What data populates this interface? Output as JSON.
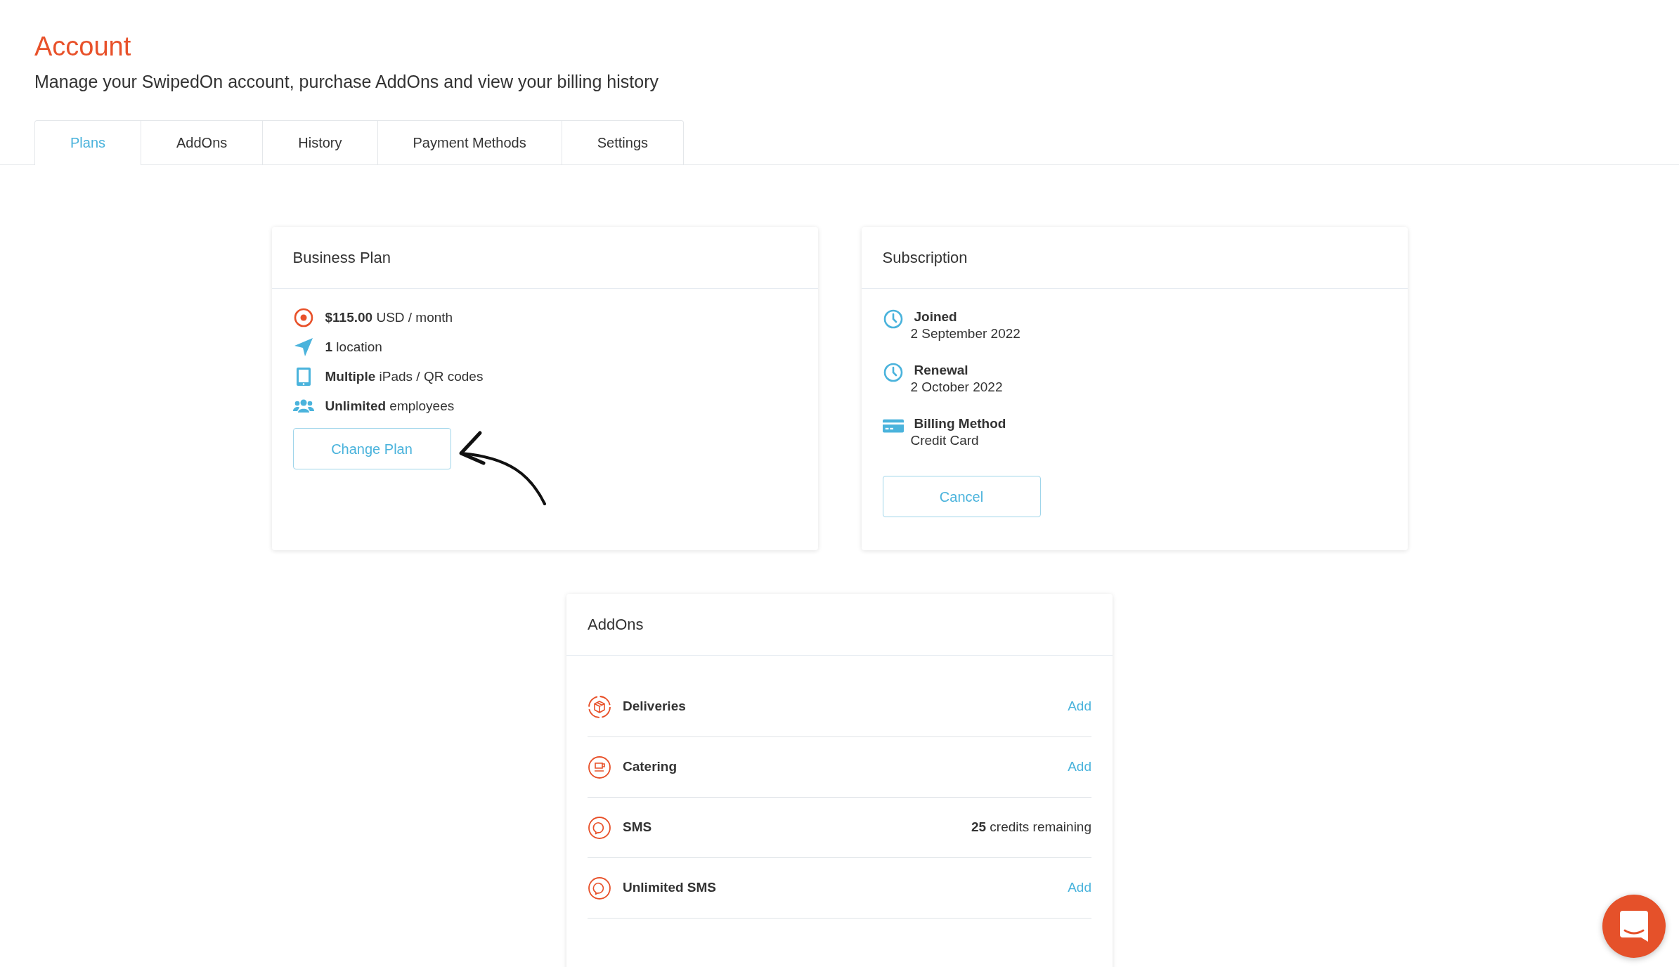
{
  "page": {
    "title": "Account",
    "subtitle": "Manage your SwipedOn account, purchase AddOns and view your billing history"
  },
  "tabs": [
    {
      "label": "Plans",
      "selected": true
    },
    {
      "label": "AddOns",
      "selected": false
    },
    {
      "label": "History",
      "selected": false
    },
    {
      "label": "Payment Methods",
      "selected": false
    },
    {
      "label": "Settings",
      "selected": false
    }
  ],
  "plan_card": {
    "title": "Business Plan",
    "features": [
      {
        "kind": "price",
        "text": "**$115.00** USD / month"
      },
      {
        "kind": "location",
        "text": "**1** location"
      },
      {
        "kind": "device",
        "text": "**Multiple** iPads / QR codes"
      },
      {
        "kind": "people",
        "text": "**Unlimited** employees"
      }
    ],
    "button": "Change Plan"
  },
  "subscription_card": {
    "title": "Subscription",
    "items": [
      {
        "kind": "date",
        "label": "Joined",
        "value": "2 September 2022"
      },
      {
        "kind": "date",
        "label": "Renewal",
        "value": "2 October 2022"
      },
      {
        "kind": "payment",
        "label": "Billing Method",
        "value": "Credit Card"
      }
    ],
    "button": "Cancel"
  },
  "addons_card": {
    "title": "AddOns",
    "items": [
      {
        "kind": "package",
        "name": "Deliveries",
        "action": "Add"
      },
      {
        "kind": "cup",
        "name": "Catering",
        "action": "Add"
      },
      {
        "kind": "chat",
        "name": "SMS",
        "status": "**25** credits remaining"
      },
      {
        "kind": "chat",
        "name": "Unlimited SMS",
        "action": "Add"
      }
    ]
  }
}
